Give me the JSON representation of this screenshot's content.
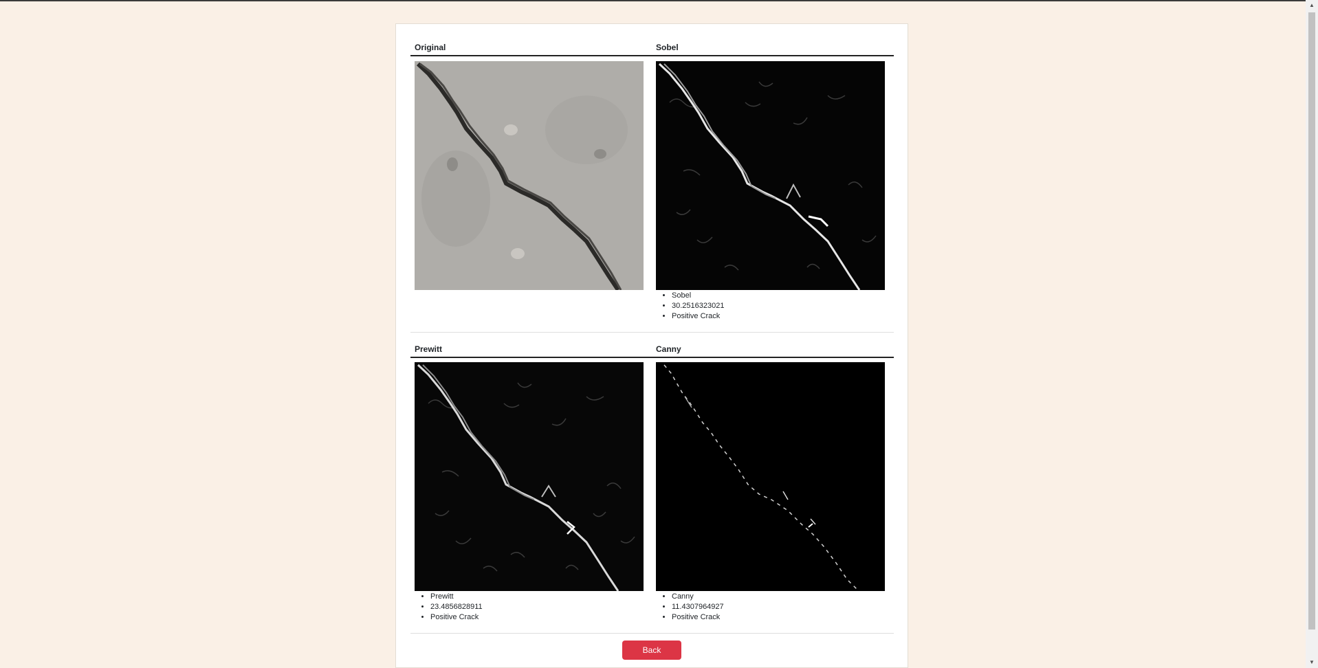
{
  "table": {
    "row1": {
      "col1_header": "Original",
      "col2_header": "Sobel",
      "col2_info": [
        "Sobel",
        "30.2516323021",
        "Positive Crack"
      ]
    },
    "row2": {
      "col1_header": "Prewitt",
      "col2_header": "Canny",
      "col1_info": [
        "Prewitt",
        "23.4856828911",
        "Positive Crack"
      ],
      "col2_info": [
        "Canny",
        "11.4307964927",
        "Positive Crack"
      ]
    }
  },
  "back_label": "Back",
  "colors": {
    "accent": "#dc3545",
    "page_bg": "#faf0e6"
  }
}
